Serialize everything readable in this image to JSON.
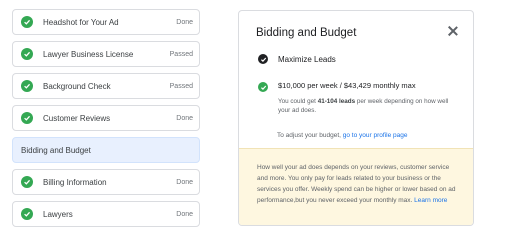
{
  "checklist": [
    {
      "label": "Headshot for Your Ad",
      "status": "Done",
      "checked": true
    },
    {
      "label": "Lawyer Business License",
      "status": "Passed",
      "checked": true
    },
    {
      "label": "Background Check",
      "status": "Passed",
      "checked": true
    },
    {
      "label": "Customer Reviews",
      "status": "Done",
      "checked": true
    },
    {
      "label": "Bidding and Budget",
      "status": "",
      "checked": false,
      "active": true
    },
    {
      "label": "Billing Information",
      "status": "Done",
      "checked": true
    },
    {
      "label": "Lawyers",
      "status": "Done",
      "checked": true
    }
  ],
  "panel": {
    "title": "Bidding and Budget",
    "option1_label": "Maximize Leads",
    "option2_title": "$10,000 per week / $43,429 monthly max",
    "option2_desc_pre": "You could get ",
    "option2_desc_bold": "41-104 leads",
    "option2_desc_post": " per week depending on how well your ad does.",
    "adjust_text": "To adjust your budget, ",
    "adjust_link": "go to your profile page",
    "info_text": "How well your ad does depends on your reviews, customer service and more. You only pay for leads related to your business or the services you offer. Weekly spend can be higher or lower based on ad performance,but you never exceed your monthly max. ",
    "info_link": "Learn more"
  },
  "colors": {
    "check_green": "#34a853",
    "active_row_bg": "#e8f0fe",
    "info_bg": "#fef7e0",
    "link_blue": "#1a73e8"
  }
}
